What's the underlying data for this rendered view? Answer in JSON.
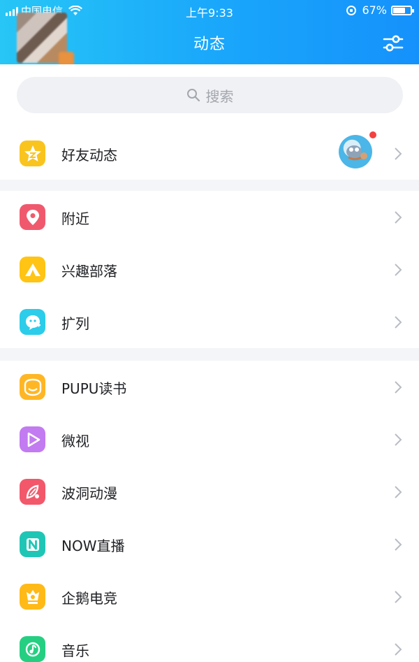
{
  "status_bar": {
    "carrier": "中国电信",
    "time": "上午9:33",
    "battery": "67%",
    "battery_level": 0.67
  },
  "header": {
    "title": "动态",
    "filter_icon": "sliders-icon"
  },
  "search": {
    "placeholder": "搜索"
  },
  "groups": [
    {
      "items": [
        {
          "label": "好友动态",
          "icon": "qzone-star-icon",
          "color": "#f9c41e",
          "has_avatar": true,
          "has_badge": true
        }
      ]
    },
    {
      "items": [
        {
          "label": "附近",
          "icon": "location-pin-icon",
          "color": "#f0596d"
        },
        {
          "label": "兴趣部落",
          "icon": "tribe-triangle-icon",
          "color": "#ffc414"
        },
        {
          "label": "扩列",
          "icon": "add-friend-icon",
          "color": "#2bcdea"
        }
      ]
    },
    {
      "items": [
        {
          "label": "PUPU读书",
          "icon": "book-icon",
          "color": "#ffb625"
        },
        {
          "label": "微视",
          "icon": "play-icon",
          "color": "#c27bf0"
        },
        {
          "label": "波洞动漫",
          "icon": "comic-icon",
          "color": "#f2586a"
        },
        {
          "label": "NOW直播",
          "icon": "now-live-icon",
          "color": "#1fc6b6"
        },
        {
          "label": "企鹅电竞",
          "icon": "esports-icon",
          "color": "#ffba18"
        },
        {
          "label": "音乐",
          "icon": "music-icon",
          "color": "#25cf82"
        }
      ]
    }
  ]
}
